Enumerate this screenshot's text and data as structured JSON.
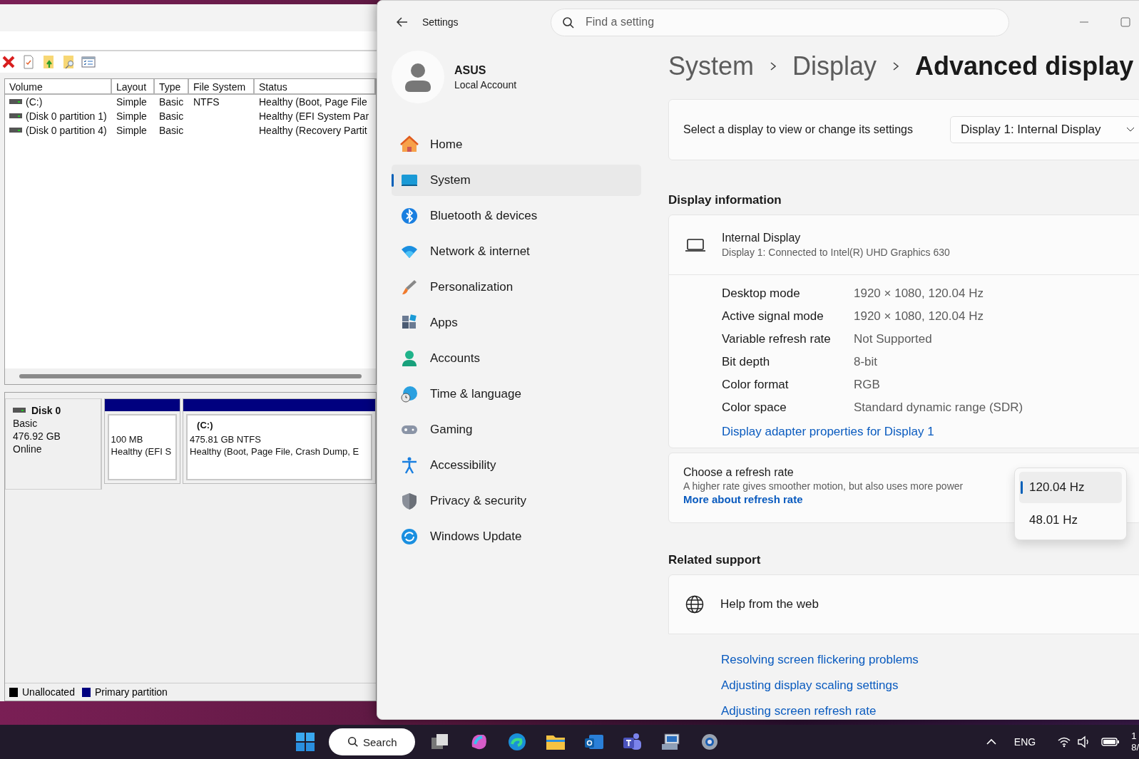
{
  "disk_management": {
    "volume_table": {
      "columns": [
        "Volume",
        "Layout",
        "Type",
        "File System",
        "Status"
      ],
      "rows": [
        {
          "cells": [
            "(C:)",
            "Simple",
            "Basic",
            "NTFS",
            "Healthy (Boot, Page File"
          ]
        },
        {
          "cells": [
            "(Disk 0 partition 1)",
            "Simple",
            "Basic",
            "",
            "Healthy (EFI System Par"
          ]
        },
        {
          "cells": [
            "(Disk 0 partition 4)",
            "Simple",
            "Basic",
            "",
            "Healthy (Recovery Partit"
          ]
        }
      ]
    },
    "disk": {
      "name": "Disk 0",
      "type": "Basic",
      "size": "476.92 GB",
      "status": "Online"
    },
    "partitions": [
      {
        "size": "100 MB",
        "status": "Healthy (EFI S"
      },
      {
        "name": "(C:)",
        "size": "475.81 GB NTFS",
        "status": "Healthy (Boot, Page File, Crash Dump, E"
      }
    ],
    "legend": [
      {
        "label": "Unallocated",
        "color": "#000000"
      },
      {
        "label": "Primary partition",
        "color": "#000080"
      }
    ]
  },
  "settings": {
    "window_title": "Settings",
    "search": {
      "placeholder": "Find a setting"
    },
    "account": {
      "name": "ASUS",
      "type": "Local Account"
    },
    "nav": [
      {
        "label": "Home",
        "selected": false
      },
      {
        "label": "System",
        "selected": true
      },
      {
        "label": "Bluetooth & devices",
        "selected": false
      },
      {
        "label": "Network & internet",
        "selected": false
      },
      {
        "label": "Personalization",
        "selected": false
      },
      {
        "label": "Apps",
        "selected": false
      },
      {
        "label": "Accounts",
        "selected": false
      },
      {
        "label": "Time & language",
        "selected": false
      },
      {
        "label": "Gaming",
        "selected": false
      },
      {
        "label": "Accessibility",
        "selected": false
      },
      {
        "label": "Privacy & security",
        "selected": false
      },
      {
        "label": "Windows Update",
        "selected": false
      }
    ],
    "breadcrumb": [
      "System",
      "Display",
      "Advanced display"
    ],
    "display_select": {
      "label": "Select a display to view or change its settings",
      "value": "Display 1: Internal Display"
    },
    "display_info": {
      "heading": "Display information",
      "name": "Internal Display",
      "connection": "Display 1: Connected to Intel(R) UHD Graphics 630",
      "properties": [
        {
          "label": "Desktop mode",
          "value": "1920 × 1080, 120.04 Hz"
        },
        {
          "label": "Active signal mode",
          "value": "1920 × 1080, 120.04 Hz"
        },
        {
          "label": "Variable refresh rate",
          "value": "Not Supported"
        },
        {
          "label": "Bit depth",
          "value": "8-bit"
        },
        {
          "label": "Color format",
          "value": "RGB"
        },
        {
          "label": "Color space",
          "value": "Standard dynamic range (SDR)"
        }
      ],
      "link": "Display adapter properties for Display 1"
    },
    "refresh": {
      "title": "Choose a refresh rate",
      "description": "A higher rate gives smoother motion, but also uses more power",
      "link": "More about refresh rate",
      "options": [
        {
          "label": "120.04 Hz",
          "selected": true
        },
        {
          "label": "48.01 Hz",
          "selected": false
        }
      ]
    },
    "related": {
      "heading": "Related support",
      "help": "Help from the web",
      "links": [
        "Resolving screen flickering problems",
        "Adjusting display scaling settings",
        "Adjusting screen refresh rate"
      ]
    }
  },
  "taskbar": {
    "search": "Search",
    "language": "ENG",
    "clock": [
      "1",
      "8/"
    ]
  }
}
